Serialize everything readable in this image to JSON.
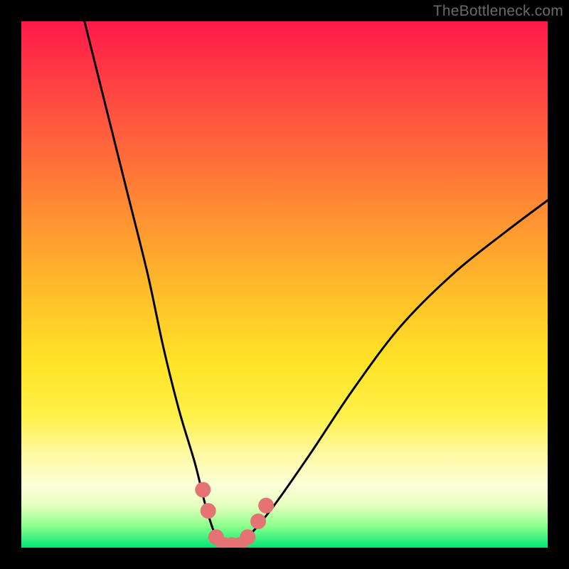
{
  "watermark": "TheBottleneck.com",
  "colors": {
    "frame": "#000000",
    "curve_stroke": "#000000",
    "marker_fill": "#e57373",
    "marker_stroke": "#e57373",
    "gradient_top": "#ff1a4a",
    "gradient_bottom": "#00e676"
  },
  "chart_data": {
    "type": "line",
    "title": "",
    "xlabel": "",
    "ylabel": "",
    "xlim": [
      0,
      100
    ],
    "ylim": [
      0,
      100
    ],
    "note": "V-shaped bottleneck curve on a red→green vertical gradient. Axis values are estimated from pixel positions; no numeric tick labels are displayed.",
    "series": [
      {
        "name": "bottleneck-curve",
        "x": [
          12,
          16,
          20,
          24,
          27,
          30,
          33,
          35,
          37,
          38.5,
          40,
          43,
          48,
          55,
          63,
          72,
          82,
          92,
          100
        ],
        "y": [
          100,
          84,
          68,
          52,
          38,
          26,
          16,
          8,
          2,
          0,
          0,
          2,
          8,
          18,
          30,
          42,
          52,
          60,
          66
        ]
      }
    ],
    "markers": [
      {
        "x": 34.5,
        "y": 11
      },
      {
        "x": 35.5,
        "y": 7
      },
      {
        "x": 37,
        "y": 2
      },
      {
        "x": 38.5,
        "y": 0.5
      },
      {
        "x": 40,
        "y": 0.5
      },
      {
        "x": 41.5,
        "y": 0.5
      },
      {
        "x": 43,
        "y": 2
      },
      {
        "x": 45,
        "y": 5
      },
      {
        "x": 46.5,
        "y": 8
      }
    ]
  }
}
